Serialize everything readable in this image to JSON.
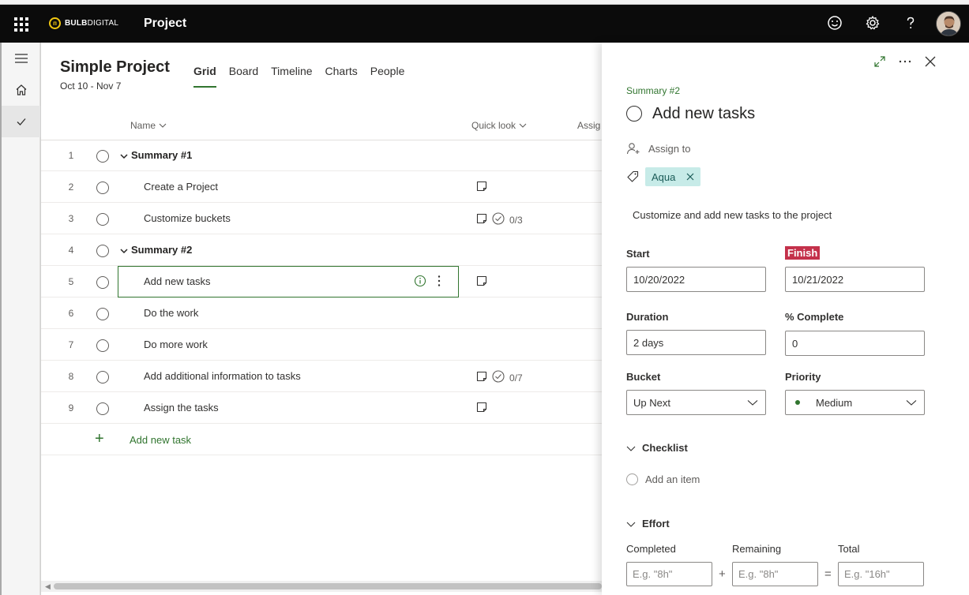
{
  "app": {
    "brand_bold": "BULB",
    "brand_rest": "DIGITAL",
    "title": "Project"
  },
  "project": {
    "title": "Simple Project",
    "dates": "Oct 10 - Nov 7",
    "tabs": [
      "Grid",
      "Board",
      "Timeline",
      "Charts",
      "People"
    ],
    "active_tab": "Grid"
  },
  "grid": {
    "columns": {
      "name": "Name",
      "quick_look": "Quick look",
      "assigned": "Assig"
    },
    "rows": [
      {
        "num": "1",
        "name": "Summary #1",
        "summary": true,
        "notes": false,
        "checklist": ""
      },
      {
        "num": "2",
        "name": "Create a Project",
        "summary": false,
        "notes": true,
        "checklist": ""
      },
      {
        "num": "3",
        "name": "Customize buckets",
        "summary": false,
        "notes": true,
        "checklist": "0/3"
      },
      {
        "num": "4",
        "name": "Summary #2",
        "summary": true,
        "notes": false,
        "checklist": ""
      },
      {
        "num": "5",
        "name": "Add new tasks",
        "summary": false,
        "notes": true,
        "checklist": "",
        "selected": true
      },
      {
        "num": "6",
        "name": "Do the work",
        "summary": false,
        "notes": false,
        "checklist": ""
      },
      {
        "num": "7",
        "name": "Do more work",
        "summary": false,
        "notes": false,
        "checklist": ""
      },
      {
        "num": "8",
        "name": "Add additional information to tasks",
        "summary": false,
        "notes": true,
        "checklist": "0/7"
      },
      {
        "num": "9",
        "name": "Assign the tasks",
        "summary": false,
        "notes": true,
        "checklist": ""
      }
    ],
    "add_task_label": "Add new task"
  },
  "panel": {
    "breadcrumb": "Summary #2",
    "task_title": "Add new tasks",
    "assign_label": "Assign to",
    "label_chip": "Aqua",
    "notes": "Customize and add new tasks to the project",
    "start_label": "Start",
    "start_value": "10/20/2022",
    "finish_label": "Finish",
    "finish_value": "10/21/2022",
    "duration_label": "Duration",
    "duration_value": "2 days",
    "complete_label": "% Complete",
    "complete_value": "0",
    "bucket_label": "Bucket",
    "bucket_value": "Up Next",
    "priority_label": "Priority",
    "priority_value": "Medium",
    "checklist_label": "Checklist",
    "checklist_add": "Add an item",
    "effort_label": "Effort",
    "completed_label": "Completed",
    "remaining_label": "Remaining",
    "total_label": "Total",
    "completed_placeholder": "E.g. \"8h\"",
    "remaining_placeholder": "E.g. \"8h\"",
    "total_placeholder": "E.g. \"16h\"",
    "plus": "+",
    "equals": "="
  },
  "colors": {
    "accent": "#31752f",
    "finish_badge": "#c4314b",
    "chip_bg": "#c7ebe8",
    "appbar": "#0b0b0b"
  }
}
